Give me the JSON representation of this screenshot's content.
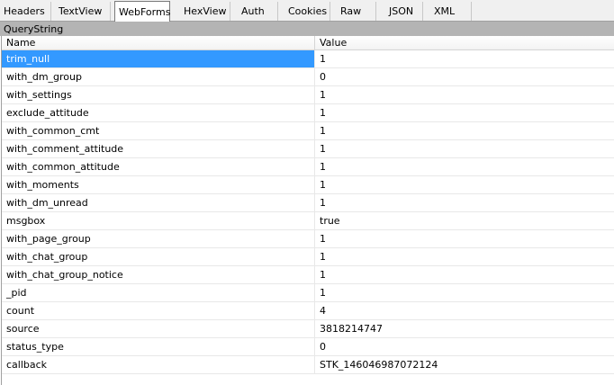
{
  "tabs": [
    {
      "label": "Headers"
    },
    {
      "label": "TextView"
    },
    {
      "label": "WebForms"
    },
    {
      "label": "HexView"
    },
    {
      "label": "Auth"
    },
    {
      "label": "Cookies"
    },
    {
      "label": "Raw"
    },
    {
      "label": "JSON"
    },
    {
      "label": "XML"
    }
  ],
  "active_tab": "WebForms",
  "section": {
    "title": "QueryString",
    "columns": {
      "name": "Name",
      "value": "Value"
    },
    "rows": [
      {
        "name": "trim_null",
        "value": "1"
      },
      {
        "name": "with_dm_group",
        "value": "0"
      },
      {
        "name": "with_settings",
        "value": "1"
      },
      {
        "name": "exclude_attitude",
        "value": "1"
      },
      {
        "name": "with_common_cmt",
        "value": "1"
      },
      {
        "name": "with_comment_attitude",
        "value": "1"
      },
      {
        "name": "with_common_attitude",
        "value": "1"
      },
      {
        "name": "with_moments",
        "value": "1"
      },
      {
        "name": "with_dm_unread",
        "value": "1"
      },
      {
        "name": "msgbox",
        "value": "true"
      },
      {
        "name": "with_page_group",
        "value": "1"
      },
      {
        "name": "with_chat_group",
        "value": "1"
      },
      {
        "name": "with_chat_group_notice",
        "value": "1"
      },
      {
        "name": "_pid",
        "value": "1"
      },
      {
        "name": "count",
        "value": "4"
      },
      {
        "name": "source",
        "value": "3818214747"
      },
      {
        "name": "status_type",
        "value": "0"
      },
      {
        "name": "callback",
        "value": "STK_146046987072124"
      }
    ],
    "selected_row": "trim_null"
  },
  "colors": {
    "selection": "#3399ff",
    "section_header": "#b4b4b4"
  }
}
